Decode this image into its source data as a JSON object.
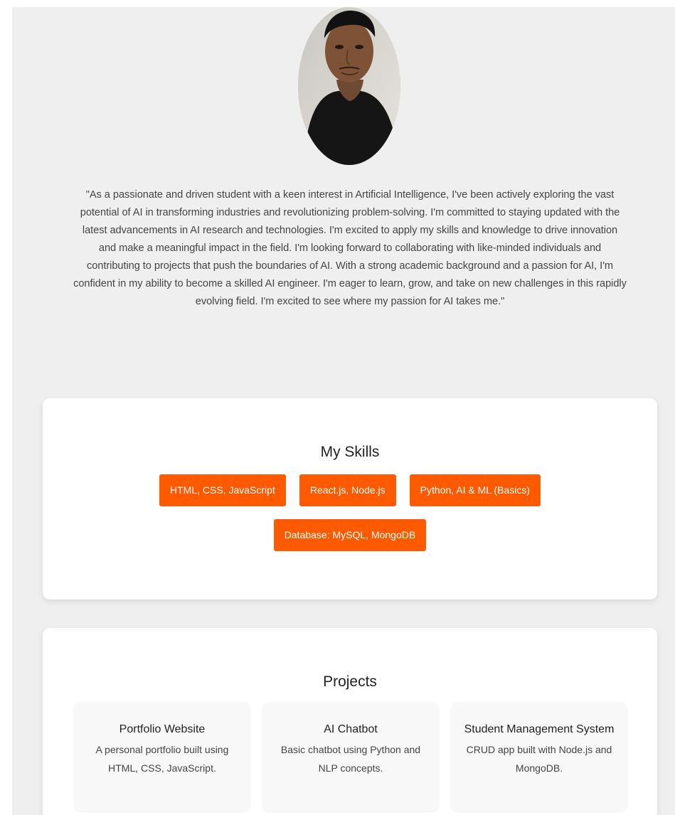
{
  "profile": {
    "about": "\"As a passionate and driven student with a keen interest in Artificial Intelligence, I've been actively exploring the vast potential of AI in transforming industries and revolutionizing problem-solving. I'm committed to staying updated with the latest advancements in AI research and technologies. I'm excited to apply my skills and knowledge to drive innovation and make a meaningful impact in the field. I'm looking forward to collaborating with like-minded individuals and contributing to projects that push the boundaries of AI. With a strong academic background and a passion for AI, I'm confident in my ability to become a skilled AI engineer. I'm eager to learn, grow, and take on new challenges in this rapidly evolving field. I'm excited to see where my passion for AI takes me.\""
  },
  "skills": {
    "title": "My Skills",
    "items": [
      "HTML, CSS, JavaScript",
      "React.js, Node.js",
      "Python, AI & ML (Basics)",
      "Database: MySQL, MongoDB"
    ],
    "accent": "#ff5a00"
  },
  "projects": {
    "title": "Projects",
    "items": [
      {
        "title": "Portfolio Website",
        "description": "A personal portfolio built using HTML, CSS, JavaScript."
      },
      {
        "title": "AI Chatbot",
        "description": "Basic chatbot using Python and NLP concepts."
      },
      {
        "title": "Student Management System",
        "description": "CRUD app built with Node.js and MongoDB."
      }
    ]
  },
  "colors": {
    "page_background": "#efefef",
    "card_background": "#ffffff"
  }
}
